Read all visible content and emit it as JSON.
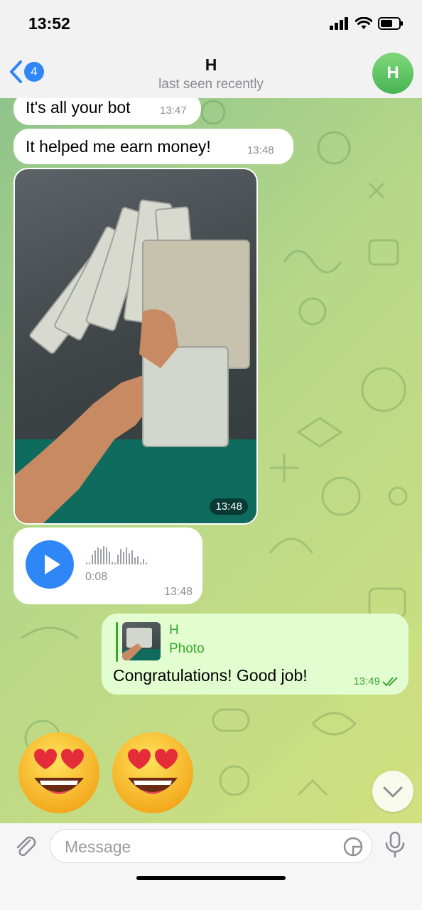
{
  "status": {
    "time": "13:52"
  },
  "header": {
    "back_count": "4",
    "title": "H",
    "subtitle": "last seen recently",
    "avatar_letter": "H"
  },
  "messages": {
    "m1": {
      "text": "It's all your bot",
      "time": "13:47"
    },
    "m2": {
      "text": "It helped me earn money!",
      "time": "13:48"
    },
    "photo": {
      "time": "13:48"
    },
    "voice": {
      "duration": "0:08",
      "time": "13:48"
    },
    "outgoing": {
      "reply_name": "H",
      "reply_kind": "Photo",
      "text": "Congratulations! Good job!",
      "time": "13:49"
    }
  },
  "emojis": [
    "smiling-face-with-heart-eyes",
    "smiling-face-with-heart-eyes"
  ],
  "input": {
    "placeholder": "Message"
  },
  "colors": {
    "accent": "#2f86f7",
    "outgoing_bubble": "#e2fdcf",
    "outgoing_text_accent": "#35a92c",
    "chat_bg_start": "#8fc48a",
    "chat_bg_end": "#d2e07f"
  }
}
